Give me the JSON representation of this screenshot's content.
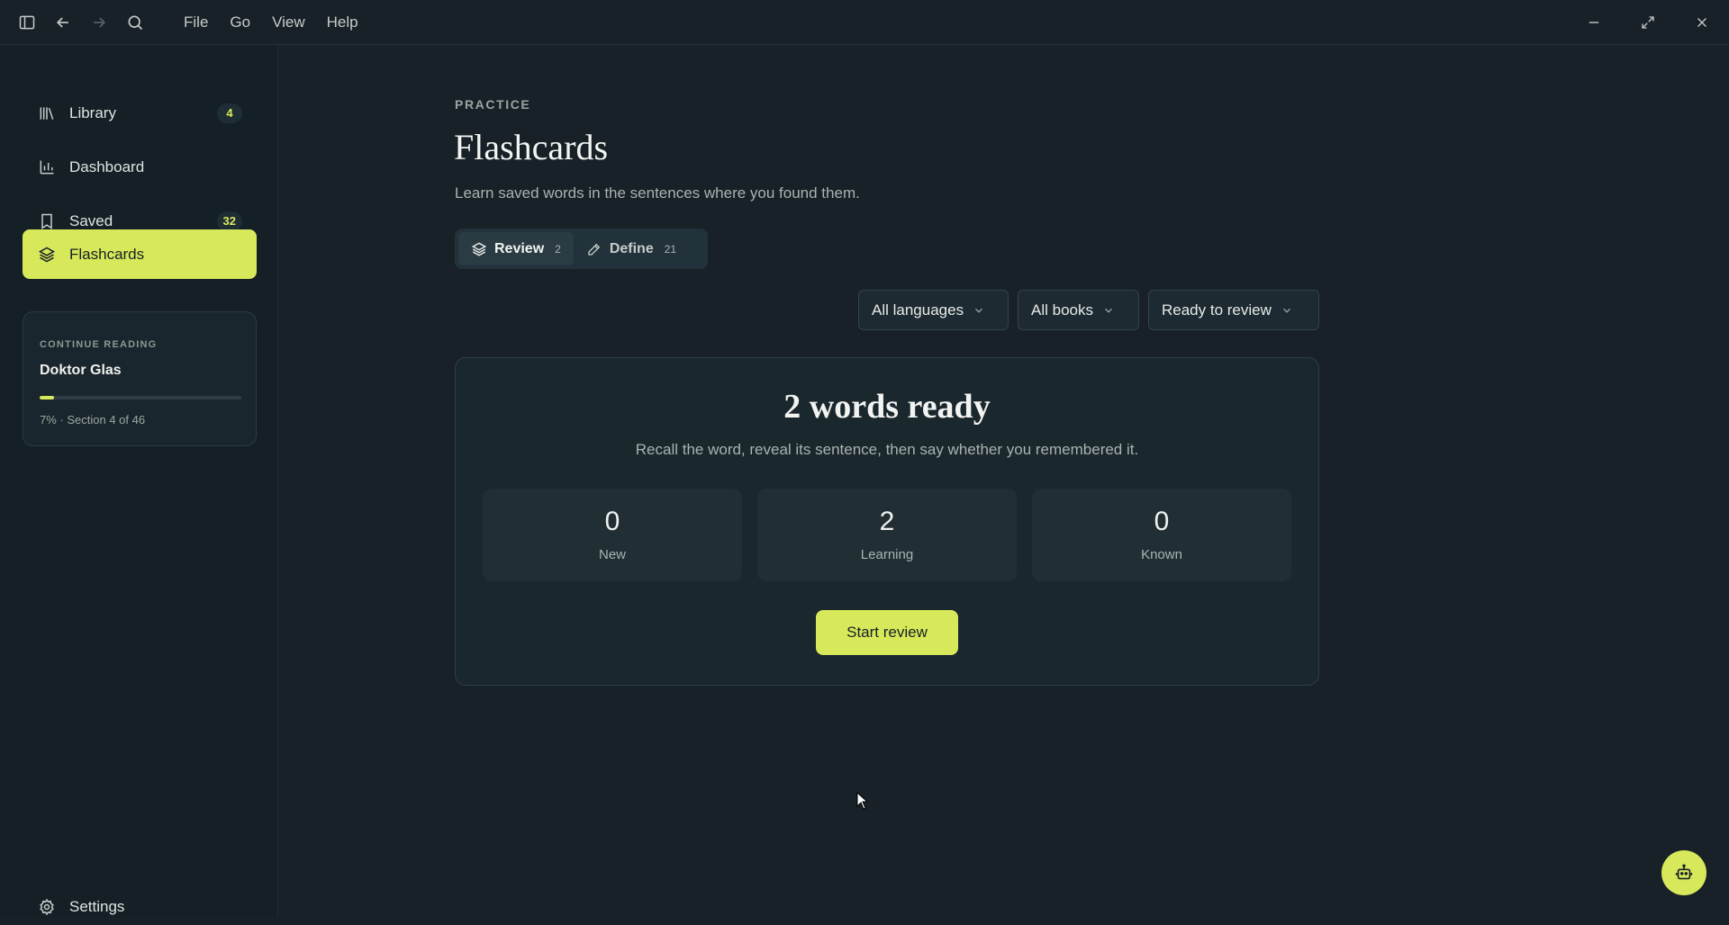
{
  "menubar": {
    "items": [
      "File",
      "Go",
      "View",
      "Help"
    ]
  },
  "sidebar": {
    "items": [
      {
        "label": "Library",
        "badge": "4",
        "icon": "library-icon"
      },
      {
        "label": "Dashboard",
        "badge": "",
        "icon": "bar-chart-icon"
      },
      {
        "label": "Saved",
        "badge": "32",
        "icon": "bookmark-icon"
      },
      {
        "label": "Flashcards",
        "badge": "",
        "icon": "layers-icon",
        "active": true
      }
    ],
    "continue_reading": {
      "kicker": "CONTINUE READING",
      "title": "Doktor Glas",
      "progress_percent": 7,
      "meta": "7% · Section 4 of 46"
    },
    "settings_label": "Settings"
  },
  "main": {
    "kicker": "PRACTICE",
    "title": "Flashcards",
    "subtitle": "Learn saved words in the sentences where you found them.",
    "tabs": [
      {
        "label": "Review",
        "count": "2",
        "active": true
      },
      {
        "label": "Define",
        "count": "21",
        "active": false
      }
    ],
    "filters": {
      "language": "All languages",
      "book": "All books",
      "status": "Ready to review"
    },
    "card": {
      "title": "2 words ready",
      "description": "Recall the word, reveal its sentence, then say whether you remembered it.",
      "stats": [
        {
          "value": "0",
          "label": "New"
        },
        {
          "value": "2",
          "label": "Learning"
        },
        {
          "value": "0",
          "label": "Known"
        }
      ],
      "start_label": "Start review"
    }
  },
  "colors": {
    "accent": "#d7e85a",
    "background": "#172127",
    "sidebar": "#142026"
  }
}
